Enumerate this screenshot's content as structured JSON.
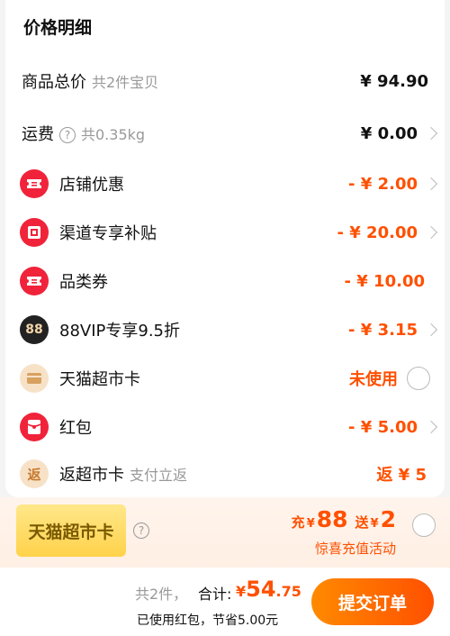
{
  "title": "价格明细",
  "rows": [
    {
      "label": "商品总价",
      "sub": "共2件宝贝",
      "amount": "¥ 94.90"
    },
    {
      "label": "运费",
      "sub": "共0.35kg",
      "amount": "¥ 0.00"
    },
    {
      "label": "店铺优惠",
      "amount": "- ¥ 2.00",
      "icon": "ticket-icon"
    },
    {
      "label": "渠道专享补贴",
      "amount": "- ¥ 20.00",
      "icon": "subsidy-icon"
    },
    {
      "label": "品类券",
      "amount": "- ¥ 10.00",
      "icon": "ticket-icon"
    },
    {
      "label": "88VIP专享9.5折",
      "amount": "- ¥ 3.15",
      "icon": "vip88-icon",
      "icon_text": "88"
    },
    {
      "label": "天猫超市卡",
      "status": "未使用",
      "icon": "card-icon"
    },
    {
      "label": "红包",
      "amount": "- ¥ 5.00",
      "icon": "red-packet-icon"
    },
    {
      "label": "返超市卡",
      "sub": "支付立返",
      "amount": "返 ¥ 5",
      "icon": "return-icon",
      "icon_text": "返"
    }
  ],
  "promo": {
    "card_text": "天猫超市卡",
    "prefix": "充",
    "charge_amount": "88",
    "mid": "送",
    "gift_amount": "2",
    "yen": "¥",
    "note": "惊喜充值活动"
  },
  "footer": {
    "count": "共2件，",
    "total_label": "合计:",
    "yen": "¥",
    "total_int": "54",
    "total_dec": ".75",
    "saved": "已使用红包，节省5.00元",
    "submit": "提交订单"
  },
  "colors": {
    "accent": "#ff5000",
    "icon_red": "#f0233a"
  }
}
